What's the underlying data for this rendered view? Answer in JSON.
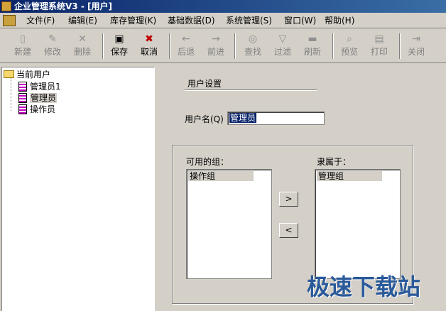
{
  "window": {
    "title": "企业管理系统V3 - [用户]"
  },
  "menu": {
    "items": [
      "文件(F)",
      "编辑(E)",
      "库存管理(K)",
      "基础数据(D)",
      "系统管理(S)",
      "窗口(W)",
      "帮助(H)"
    ]
  },
  "toolbar": {
    "new": "新建",
    "edit": "修改",
    "delete": "删除",
    "save": "保存",
    "cancel": "取消",
    "back": "后退",
    "forward": "前进",
    "find": "查找",
    "filter": "过滤",
    "refresh": "刷新",
    "preview": "预览",
    "print": "打印",
    "close": "关闭"
  },
  "tree": {
    "root": "当前用户",
    "children": [
      "管理员1",
      "管理员",
      "操作员"
    ]
  },
  "form": {
    "section_title": "用户设置",
    "username_label": "用户名(Q)",
    "username_value": "管理员",
    "available_label": "可用的组：",
    "member_label": "隶属于：",
    "available_groups": [
      "操作组"
    ],
    "member_groups": [
      "管理组"
    ],
    "add_arrow": ">",
    "remove_arrow": "<"
  },
  "watermark": "极速下载站"
}
